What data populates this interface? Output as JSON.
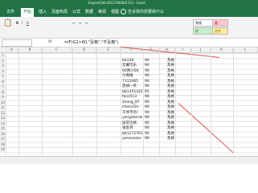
{
  "titlebar": {
    "text": "Export(Odin20170608)2313 - Excel"
  },
  "tabs": [
    "文件",
    "开始",
    "插入",
    "页面布局",
    "公式",
    "数据",
    "审阅",
    "视图"
  ],
  "active_tab": "开始",
  "tell_me": "告诉我你想要做什么",
  "ribbon": {
    "styles": [
      "常规",
      "差",
      "好",
      "适中"
    ]
  },
  "formula_bar": {
    "fx": "fx",
    "formula": "=IF(G2>60,\"及格\",\"不及格\")"
  },
  "columns": [
    "A",
    "B",
    "C",
    "D",
    "E",
    "F",
    "G",
    "H",
    "I",
    "J",
    "K",
    "L"
  ],
  "rows": [
    {
      "num": "1",
      "name": "",
      "score": "",
      "result": ""
    },
    {
      "num": "2",
      "name": "bb129",
      "score": "90",
      "result": "及格"
    },
    {
      "num": "3",
      "name": "云翼可乐",
      "score": "90",
      "result": "及格"
    },
    {
      "num": "4",
      "name": "00青川00",
      "score": "90",
      "result": "及格"
    },
    {
      "num": "5",
      "name": "冷煮梅",
      "score": "90",
      "result": "及格"
    },
    {
      "num": "6",
      "name": "7311065",
      "score": "90",
      "result": "及格"
    },
    {
      "num": "7",
      "name": "黑胡一笑",
      "score": "90",
      "result": "及格"
    },
    {
      "num": "8",
      "name": "bb1355322",
      "score": "65",
      "result": "及格"
    },
    {
      "num": "9",
      "name": "fanz513",
      "score": "90",
      "result": "及格"
    },
    {
      "num": "10",
      "name": "zhang_87",
      "score": "90",
      "result": "及格"
    },
    {
      "num": "11",
      "name": "chencf2n",
      "score": "90",
      "result": "及格"
    },
    {
      "num": "12",
      "name": "千寻不尽r",
      "score": "90",
      "result": "及格"
    },
    {
      "num": "13",
      "name": "yangdanrw",
      "score": "90",
      "result": "及格"
    },
    {
      "num": "14",
      "name": "加芬吉格",
      "score": "90",
      "result": "及格"
    },
    {
      "num": "15",
      "name": "张思邻",
      "score": "90",
      "result": "及格"
    },
    {
      "num": "16",
      "name": "bb1272761",
      "score": "90",
      "result": "及格"
    },
    {
      "num": "17",
      "name": "yanxunzxc",
      "score": "90",
      "result": "及格"
    },
    {
      "num": "18",
      "name": "",
      "score": "",
      "result": ""
    },
    {
      "num": "19",
      "name": "",
      "score": "",
      "result": ""
    }
  ]
}
